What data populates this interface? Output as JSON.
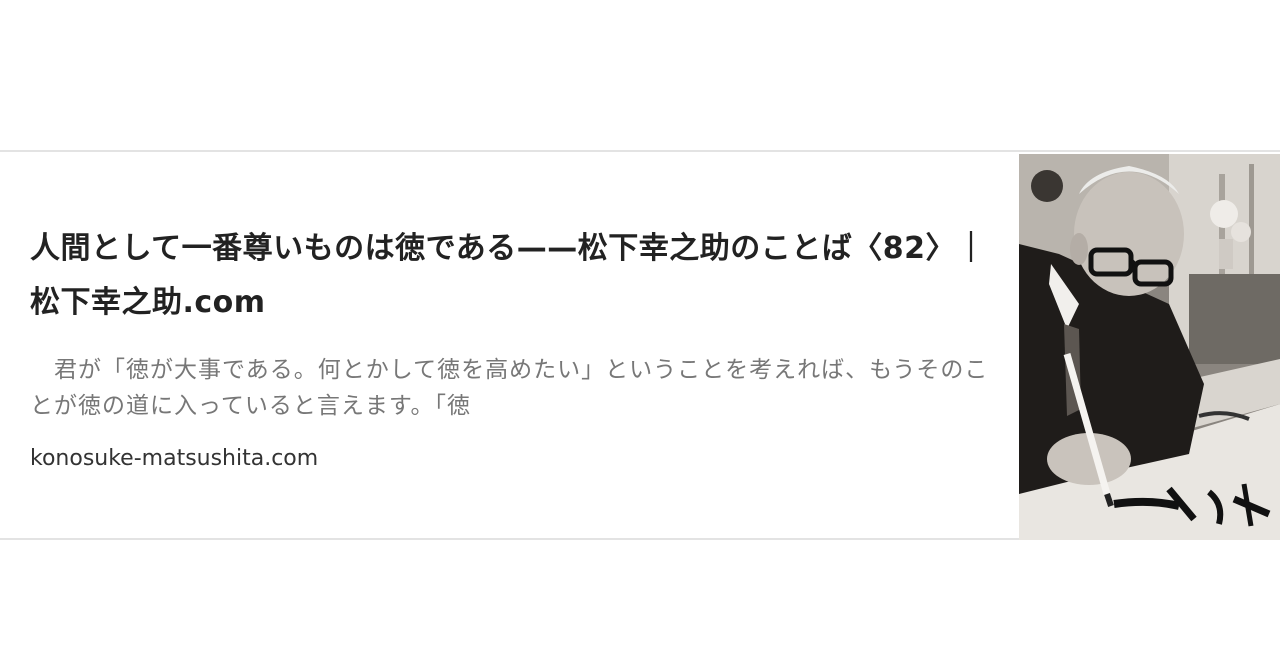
{
  "card": {
    "title": "人間として一番尊いものは徳である——松下幸之助のことば〈82〉｜松下幸之助.com",
    "description": "　君が「徳が大事である。何とかして徳を高めたい」ということを考えれば、もうそのことが徳の道に入っていると言えます。「徳",
    "domain": "konosuke-matsushita.com"
  }
}
